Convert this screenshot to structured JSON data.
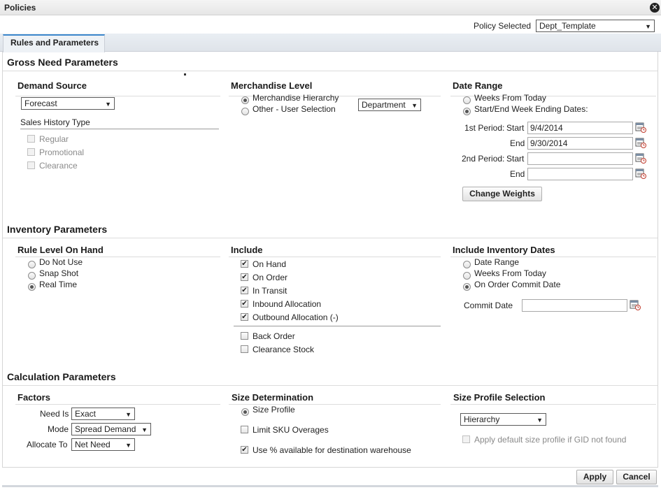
{
  "window": {
    "title": "Policies",
    "close_icon": "close-icon"
  },
  "policy_selector": {
    "label": "Policy Selected",
    "value": "Dept_Template"
  },
  "tabs": [
    {
      "label": "Rules and Parameters",
      "active": true
    }
  ],
  "gross_need": {
    "title": "Gross Need Parameters",
    "demand_source": {
      "heading": "Demand Source",
      "value": "Forecast",
      "sales_history_heading": "Sales History Type",
      "sales_history": [
        {
          "label": "Regular",
          "checked": false,
          "disabled": true
        },
        {
          "label": "Promotional",
          "checked": false,
          "disabled": true
        },
        {
          "label": "Clearance",
          "checked": false,
          "disabled": true
        }
      ]
    },
    "merchandise_level": {
      "heading": "Merchandise Level",
      "options": [
        {
          "label": "Merchandise Hierarchy",
          "selected": true
        },
        {
          "label": "Other - User Selection",
          "selected": false
        }
      ],
      "level_value": "Department"
    },
    "date_range": {
      "heading": "Date Range",
      "options": [
        {
          "label": "Weeks From Today",
          "selected": false
        },
        {
          "label": "Start/End Week Ending Dates:",
          "selected": true
        }
      ],
      "first_period_label": "1st Period:",
      "second_period_label": "2nd Period:",
      "start_label": "Start",
      "end_label": "End",
      "first_start": "9/4/2014",
      "first_end": "9/30/2014",
      "second_start": "",
      "second_end": "",
      "change_weights_label": "Change Weights"
    }
  },
  "inventory": {
    "title": "Inventory Parameters",
    "rule_level": {
      "heading": "Rule Level On Hand",
      "options": [
        {
          "label": "Do Not Use",
          "selected": false
        },
        {
          "label": "Snap Shot",
          "selected": false
        },
        {
          "label": "Real Time",
          "selected": true
        }
      ]
    },
    "include": {
      "heading": "Include",
      "checked_items": [
        {
          "label": "On Hand",
          "checked": true
        },
        {
          "label": "On Order",
          "checked": true
        },
        {
          "label": "In Transit",
          "checked": true
        },
        {
          "label": "Inbound Allocation",
          "checked": true
        },
        {
          "label": "Outbound Allocation (-)",
          "checked": true
        }
      ],
      "other_items": [
        {
          "label": "Back Order",
          "checked": false
        },
        {
          "label": "Clearance Stock",
          "checked": false
        }
      ]
    },
    "include_dates": {
      "heading": "Include Inventory Dates",
      "options": [
        {
          "label": "Date Range",
          "selected": false
        },
        {
          "label": "Weeks From Today",
          "selected": false
        },
        {
          "label": "On Order Commit Date",
          "selected": true
        }
      ],
      "commit_date_label": "Commit Date",
      "commit_date_value": ""
    }
  },
  "calculation": {
    "title": "Calculation Parameters",
    "factors": {
      "heading": "Factors",
      "need_is_label": "Need Is",
      "need_is_value": "Exact",
      "mode_label": "Mode",
      "mode_value": "Spread Demand",
      "allocate_to_label": "Allocate To",
      "allocate_to_value": "Net Need"
    },
    "size_determination": {
      "heading": "Size Determination",
      "size_profile_label": "Size Profile",
      "size_profile_selected": true,
      "limit_sku_label": "Limit SKU Overages",
      "limit_sku_checked": false,
      "use_pct_label": "Use % available for destination warehouse",
      "use_pct_checked": true
    },
    "size_profile_selection": {
      "heading": "Size Profile Selection",
      "value": "Hierarchy",
      "apply_default_label": "Apply default size profile if GID not found",
      "apply_default_checked": false
    }
  },
  "footer": {
    "apply_label": "Apply",
    "cancel_label": "Cancel"
  }
}
